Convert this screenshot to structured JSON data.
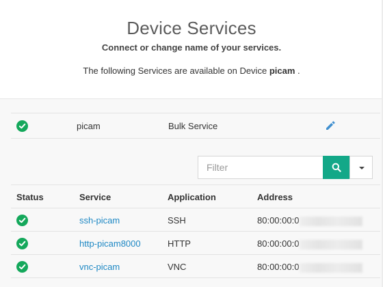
{
  "header": {
    "title": "Device Services",
    "subtitle": "Connect or change name of your services.",
    "description_prefix": "The following Services are available on Device",
    "device_name": "picam",
    "description_suffix": " ."
  },
  "device_row": {
    "status": "connected",
    "name": "picam",
    "service_type": "Bulk Service",
    "edit_icon": "pencil-icon"
  },
  "filter": {
    "placeholder": "Filter",
    "value": "",
    "search_icon": "search-icon",
    "dropdown_icon": "caret-down-icon"
  },
  "table": {
    "headers": [
      "Status",
      "Service",
      "Application",
      "Address"
    ],
    "rows": [
      {
        "status": "connected",
        "service": "ssh-picam",
        "application": "SSH",
        "address_prefix": "80:00:00:0"
      },
      {
        "status": "connected",
        "service": "http-picam8000",
        "application": "HTTP",
        "address_prefix": "80:00:00:0"
      },
      {
        "status": "connected",
        "service": "vnc-picam",
        "application": "VNC",
        "address_prefix": "80:00:00:0"
      }
    ]
  },
  "colors": {
    "status_green": "#14a85b",
    "search_button": "#13a888",
    "link": "#1e88c4",
    "title": "#5b5b5b"
  }
}
